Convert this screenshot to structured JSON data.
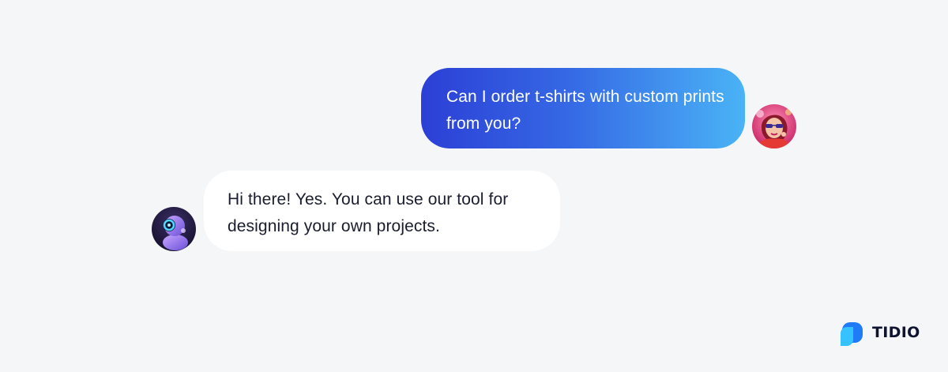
{
  "conversation": {
    "messages": [
      {
        "sender": "customer",
        "text": "Can I order t-shirts with custom prints from you?",
        "avatar_icon": "customer-avatar-icon"
      },
      {
        "sender": "bot",
        "text": "Hi there! Yes. You can use our tool for designing your own projects.",
        "avatar_icon": "robot-avatar-icon"
      }
    ]
  },
  "brand": {
    "name": "TIDIO",
    "logo_icon": "tidio-logo-icon"
  },
  "colors": {
    "background": "#f5f6f8",
    "user_bubble_gradient_start": "#2c3fd6",
    "user_bubble_gradient_end": "#4ab3f6",
    "bot_bubble": "#ffffff",
    "text_dark": "#1a1d2e",
    "brand_blue": "#1f7bf6"
  }
}
